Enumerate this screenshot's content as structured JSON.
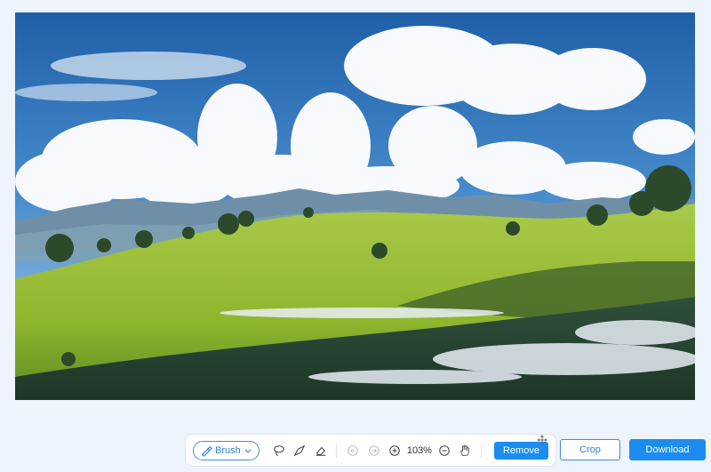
{
  "toolbar": {
    "brush_label": "Brush",
    "zoom_level": "103%",
    "remove_label": "Remove",
    "icons": [
      "brush-icon",
      "chevron-down-icon",
      "lasso-icon",
      "pen-icon",
      "eraser-icon",
      "undo-icon",
      "redo-icon",
      "zoom-in-icon",
      "zoom-out-icon",
      "hand-icon",
      "move-icon"
    ]
  },
  "actions": {
    "crop_label": "Crop",
    "download_label": "Download"
  },
  "colors": {
    "accent": "#1b8df0",
    "background": "#eef4fb"
  }
}
